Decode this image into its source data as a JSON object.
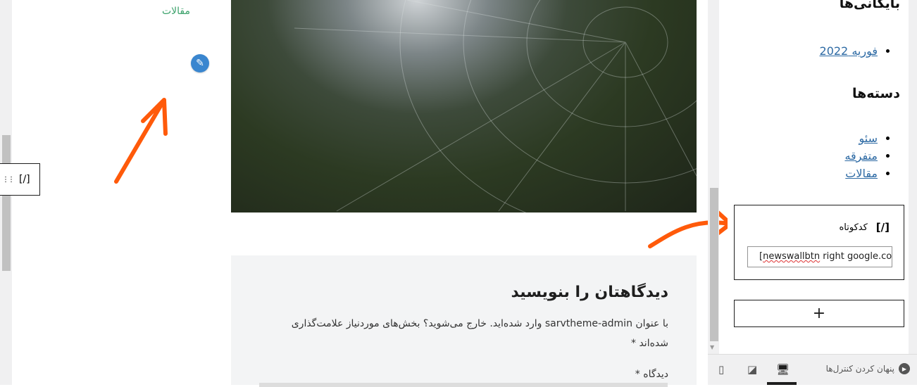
{
  "left": {
    "category": "مقالات",
    "block_toolbar": {
      "drag": "⋮⋮",
      "shortcode": "[/]"
    }
  },
  "comment": {
    "title": "دیدگاهتان را بنویسید",
    "intro": "با عنوان sarvtheme-admin وارد شده‌اید. خارج می‌شوید؟ بخش‌های موردنیاز علامت‌گذاری شده‌اند *",
    "comment_label": "دیدگاه *"
  },
  "sidebar": {
    "archives_title": "بایگانی‌ها",
    "archives": [
      "فوریه 2022"
    ],
    "categories_title": "دسته‌ها",
    "categories": [
      "سئو",
      "متفرقه",
      "مقالات"
    ],
    "shortcode_block": {
      "icon": "[/]",
      "label": "کدکوتاه",
      "value_word": "newswallbtn",
      "value_rest": " right google.com]",
      "value_open": "["
    },
    "add_block": "+"
  },
  "footer": {
    "hide_controls": "پنهان کردن کنترل‌ها"
  },
  "colors": {
    "accent": "#3a86cf",
    "link": "#2d6aa4",
    "category": "#3aa16a",
    "arrow": "#ff5a0a"
  }
}
